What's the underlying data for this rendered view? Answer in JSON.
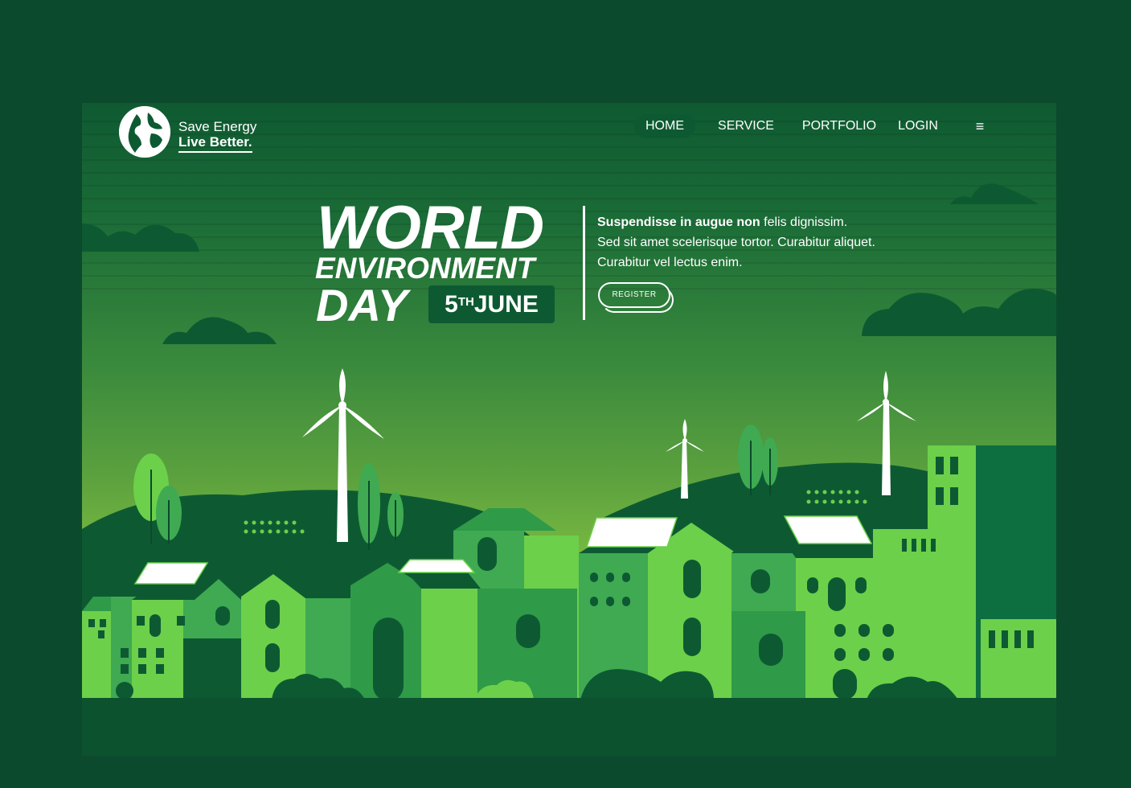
{
  "logo": {
    "line1": "Save Energy",
    "line2": "Live Better."
  },
  "nav": {
    "home": "HOME",
    "service": "SERVICE",
    "portfolio": "PORTFOLIO",
    "login": "LOGIN",
    "menu_icon": "≡"
  },
  "hero": {
    "title_line1": "WORLD",
    "title_line2": "ENVIRONMENT",
    "title_line3": "DAY",
    "date_num": "5",
    "date_sup": "TH",
    "date_month": "JUNE",
    "desc_bold": "Suspendisse in augue non",
    "desc_rest": " felis dignissim.",
    "desc_line2": "Sed sit amet scelerisque tortor. Curabitur aliquet.",
    "desc_line3": "Curabitur vel lectus enim.",
    "register_label": "REGISTER"
  },
  "colors": {
    "outer_bg": "#0b4a2c",
    "dark_green": "#0d5a32",
    "light_green": "#6cd04a",
    "accent_green": "#86c443"
  },
  "icons": {
    "logo": "globe-icon",
    "menu": "hamburger-menu-icon"
  }
}
